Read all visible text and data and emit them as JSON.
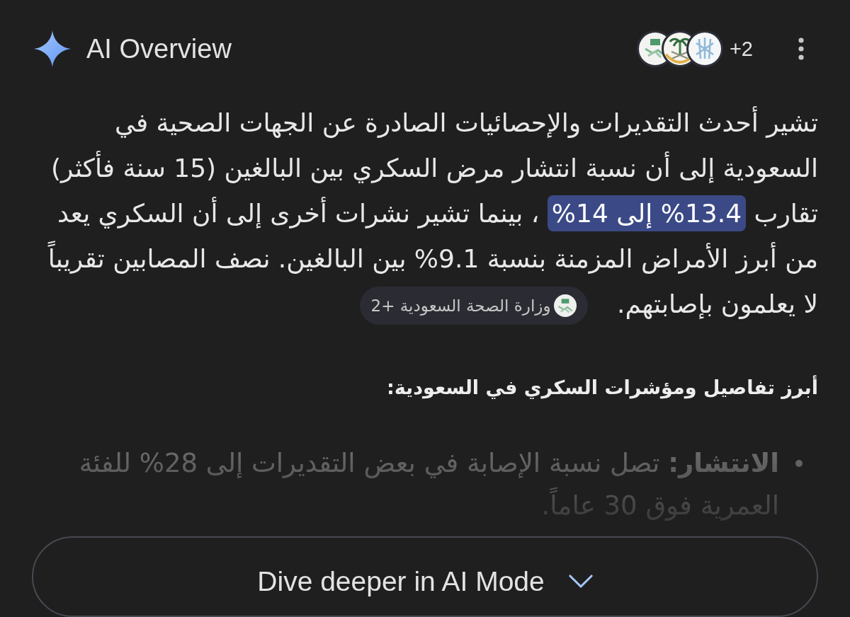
{
  "header": {
    "title": "AI Overview",
    "sources_more": "+2"
  },
  "overview": {
    "expanded": false,
    "paragraph": [
      {
        "text": "تشير أحدث التقديرات والإحصائيات الصادرة عن الجهات الصحية في السعودية إلى أن نسبة انتشار مرض السكري بين البالغين (15 سنة فأكثر) تقارب",
        "highlighted": false
      },
      {
        "text": "13.4% إلى 14%",
        "highlighted": true
      },
      {
        "text": "، بينما تشير نشرات أخرى إلى أن السكري يعد من أبرز الأمراض المزمنة بنسبة 9.1% بين البالغين. نصف المصابين تقريباً لا يعلمون بإصابتهم.",
        "highlighted": false
      }
    ],
    "source_chip": {
      "label": "وزارة الصحة السعودية +2"
    },
    "heading": "أبرز تفاصيل ومؤشرات السكري في السعودية:",
    "bullets": [
      "**الانتشار:** تصل نسبة الإصابة في بعض التقديرات إلى 28% للفئة العمرية فوق 30 عاماً."
    ]
  },
  "dive_button": {
    "label": "Dive deeper in AI Mode"
  }
}
